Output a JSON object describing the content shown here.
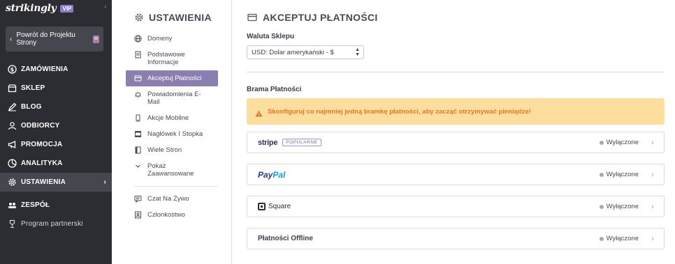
{
  "sidebar": {
    "brand": "strikingly",
    "vip_badge": "VIP",
    "back_button": "Powrót do Projektu Strony",
    "items": [
      {
        "label": "ZAMÓWIENIA",
        "icon": "dollar-circle-icon"
      },
      {
        "label": "SKLEP",
        "icon": "store-icon"
      },
      {
        "label": "BLOG",
        "icon": "pen-icon"
      },
      {
        "label": "ODBIORCY",
        "icon": "users-icon"
      },
      {
        "label": "PROMOCJA",
        "icon": "megaphone-icon"
      },
      {
        "label": "ANALITYKA",
        "icon": "analytics-icon"
      },
      {
        "label": "USTAWIENIA",
        "icon": "gear-icon"
      },
      {
        "label": "ZESPÓŁ",
        "icon": "team-icon"
      },
      {
        "label": "Program partnerski",
        "icon": "trophy-icon"
      }
    ]
  },
  "settings": {
    "title": "USTAWIENIA",
    "menu": [
      {
        "label": "Domeny",
        "icon": "globe-icon"
      },
      {
        "label": "Podstawowe Informacje",
        "icon": "document-icon"
      },
      {
        "label": "Akceptuj Płatności",
        "icon": "credit-card-icon"
      },
      {
        "label": "Powiadomienia E-Mail",
        "icon": "bell-icon"
      },
      {
        "label": "Akcje Mobilne",
        "icon": "mobile-icon"
      },
      {
        "label": "Nagłówek I Stopka",
        "icon": "layout-icon"
      },
      {
        "label": "Wiele Stron",
        "icon": "pages-icon"
      },
      {
        "label": "Pokaż Zaawansowane",
        "icon": "chevron-down-icon"
      },
      {
        "label": "Czat Na Żywo",
        "icon": "chat-icon"
      },
      {
        "label": "Członkostwo",
        "icon": "member-icon"
      }
    ]
  },
  "main": {
    "title": "AKCEPTUJ PŁATNOŚCI",
    "currency_label": "Waluta Sklepu",
    "currency_value": "USD: Dolar amerykański - $",
    "gateway_label": "Brama Płatności",
    "warning": "Skonfiguruj co najmniej jedną bramkę płatności, aby zacząć otrzymywać pieniądze!",
    "gateways": {
      "stripe": {
        "logo": "stripe",
        "badge": "POPULARNE",
        "status": "Wyłączone"
      },
      "paypal": {
        "logo_part1": "Pay",
        "logo_part2": "Pal",
        "status": "Wyłączone"
      },
      "square": {
        "logo": "Square",
        "status": "Wyłączone"
      },
      "offline": {
        "label": "Płatności Offline",
        "status": "Wyłączone"
      }
    }
  },
  "colors": {
    "sidebar_bg": "#2c2d33",
    "accent_purple": "#8b7fb0",
    "warning_bg": "#fcdf9e",
    "warning_text": "#e8752b"
  }
}
